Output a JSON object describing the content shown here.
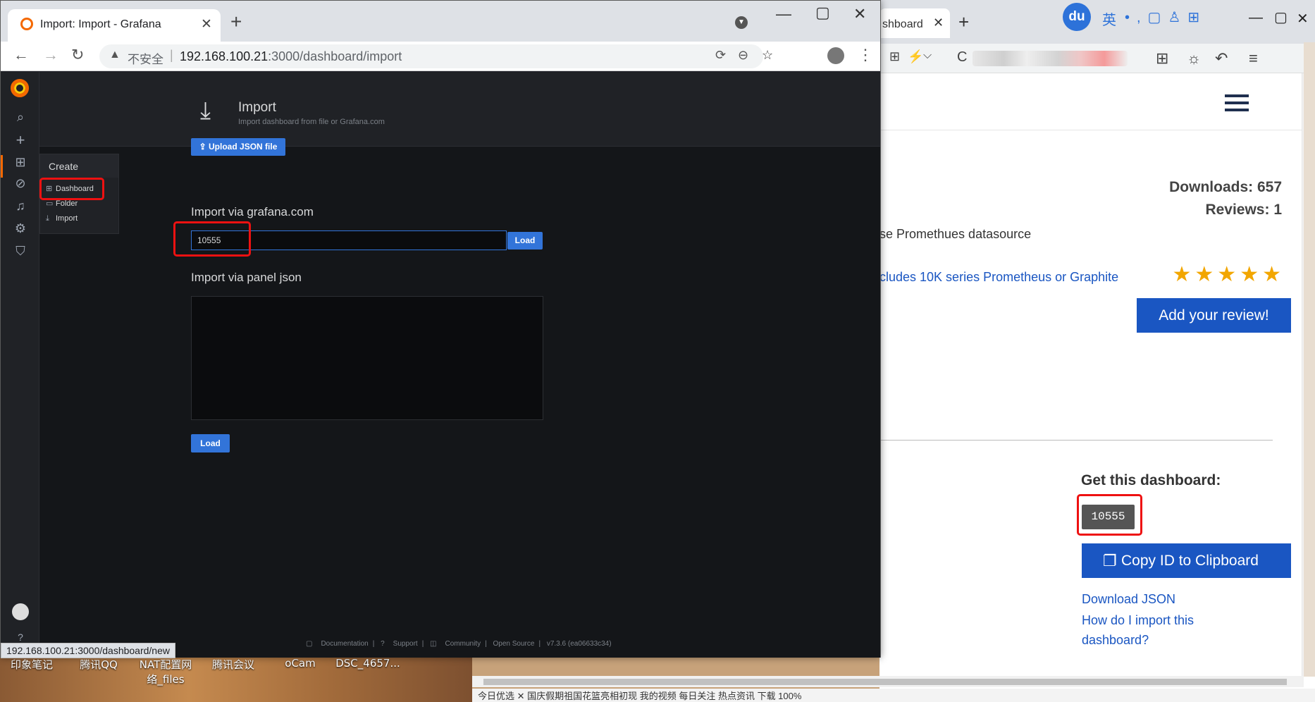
{
  "desktop": {
    "icons": [
      "印象笔记",
      "腾讯QQ",
      "NAT配置网络_files",
      "腾讯会议",
      "oCam",
      "DSC_4657..."
    ]
  },
  "left_browser": {
    "tab_title": "Import: Import - Grafana",
    "insecure_label": "不安全",
    "url_host": "192.168.100.21",
    "url_path": ":3000/dashboard/import",
    "hover_url": "192.168.100.21:3000/dashboard/new"
  },
  "grafana": {
    "page_title": "Import",
    "page_subtitle": "Import dashboard from file or Grafana.com",
    "create_menu": {
      "header": "Create",
      "items": [
        "Dashboard",
        "Folder",
        "Import"
      ]
    },
    "upload_button": "Upload JSON file",
    "grafana_com_label": "Import via grafana.com",
    "grafana_com_value": "10555",
    "load_button": "Load",
    "panel_json_label": "Import via panel json",
    "load_button_2": "Load",
    "footer": {
      "documentation": "Documentation",
      "support": "Support",
      "community": "Community",
      "open_source": "Open Source",
      "version": "v7.3.6 (ea06633c34)"
    },
    "accent_color": "#3274d9",
    "brand_color": "#f46800"
  },
  "right_browser": {
    "tab_title": "shboard",
    "ime_label": "英",
    "baidu_badge": "du",
    "downloads": "Downloads: 657",
    "reviews": "Reviews: 1",
    "stars": "★★★★★",
    "add_review": "Add your review!",
    "snippet_1": "se Promethues datasource",
    "snippet_2": "cludes 10K series Prometheus or Graphite",
    "get_dashboard": "Get this dashboard:",
    "dashboard_id": "10555",
    "copy_button": "Copy ID to Clipboard",
    "download_json": "Download JSON",
    "how_import": "How do I import this dashboard?",
    "statusbar": "今日优选   ✕ 国庆假期祖国花篮亮相初现   我的视频   每日关注   热点资讯          下载          100%"
  }
}
